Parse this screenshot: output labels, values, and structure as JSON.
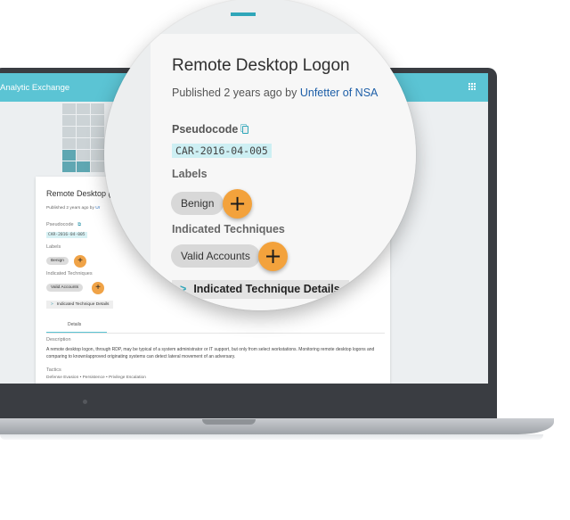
{
  "app": {
    "title": "Analytic Exchange",
    "colors": {
      "appbar": "#5bc4d4",
      "accent": "#f3a23c",
      "link": "#1e5fa8",
      "code_bg": "#cdeff3"
    }
  },
  "analytic": {
    "title": "Remote Desktop Logon",
    "title_truncated": "Remote Desktop (",
    "published_prefix": "Published 2 years ago by ",
    "author": "Unfetter of NSA",
    "author_truncated": "Ur",
    "pseudocode_label": "Pseudocode",
    "code": "CAR-2016-04-005",
    "labels_heading": "Labels",
    "labels": [
      "Benign"
    ],
    "techniques_heading": "Indicated Techniques",
    "techniques": [
      "Valid Accounts"
    ],
    "details_button": "Indicated Technique Details",
    "add_icon": "plus-icon",
    "copy_icon": "copy-icon",
    "chevron_icon": "chevron-right-icon",
    "tab_details": "Details",
    "description_heading": "Description",
    "description": "A remote desktop logon, through RDP, may be typical of a system administrator or IT support, but only from select workstations. Monitoring remote desktop logons and comparing to known/approved originating systems can detect lateral movement of an adversary.",
    "tactics_heading": "Tactics",
    "tactics": "Defense Evasion • Persistence • Privilege Escalation"
  }
}
